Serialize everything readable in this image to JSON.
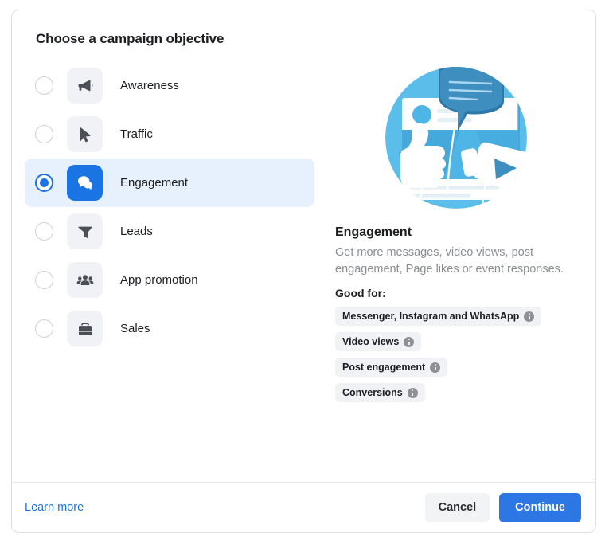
{
  "dialog": {
    "title": "Choose a campaign objective"
  },
  "objectives": [
    {
      "label": "Awareness",
      "icon": "megaphone-icon",
      "selected": false
    },
    {
      "label": "Traffic",
      "icon": "cursor-icon",
      "selected": false
    },
    {
      "label": "Engagement",
      "icon": "chat-bubbles-icon",
      "selected": true
    },
    {
      "label": "Leads",
      "icon": "funnel-icon",
      "selected": false
    },
    {
      "label": "App promotion",
      "icon": "people-group-icon",
      "selected": false
    },
    {
      "label": "Sales",
      "icon": "briefcase-icon",
      "selected": false
    }
  ],
  "detail": {
    "illustration": "engagement-illustration",
    "title": "Engagement",
    "description": "Get more messages, video views, post engagement, Page likes or event responses.",
    "good_for_label": "Good for:",
    "chips": [
      "Messenger, Instagram and WhatsApp",
      "Video views",
      "Post engagement",
      "Conversions"
    ]
  },
  "footer": {
    "learn_more": "Learn more",
    "cancel": "Cancel",
    "continue": "Continue"
  },
  "colors": {
    "accent_blue": "#1b74e4",
    "button_blue": "#2d77e5",
    "selected_row_bg": "#e7f0fd",
    "tile_gray": "#f0f2f5",
    "text_primary": "#1c1e21",
    "text_muted": "#8a8d91",
    "illustration_light_blue": "#5bbdea",
    "illustration_dark_blue": "#2e77a8"
  }
}
